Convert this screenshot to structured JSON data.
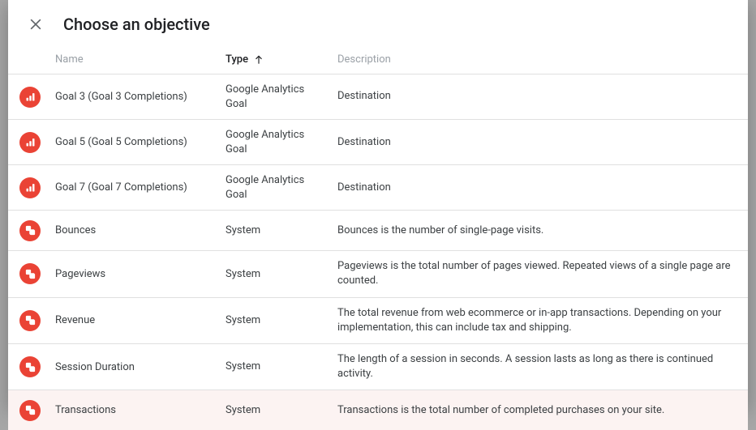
{
  "dialog": {
    "title": "Choose an objective"
  },
  "columns": {
    "name": "Name",
    "type": "Type",
    "description": "Description"
  },
  "rows": [
    {
      "iconType": "ga",
      "name": "Goal 3 (Goal 3 Completions)",
      "type": "Google Analytics Goal",
      "description": "Destination",
      "highlight": false
    },
    {
      "iconType": "ga",
      "name": "Goal 5 (Goal 5 Completions)",
      "type": "Google Analytics Goal",
      "description": "Destination",
      "highlight": false
    },
    {
      "iconType": "ga",
      "name": "Goal 7 (Goal 7 Completions)",
      "type": "Google Analytics Goal",
      "description": "Destination",
      "highlight": false
    },
    {
      "iconType": "system",
      "name": "Bounces",
      "type": "System",
      "description": "Bounces is the number of single-page visits.",
      "highlight": false
    },
    {
      "iconType": "system",
      "name": "Pageviews",
      "type": "System",
      "description": "Pageviews is the total number of pages viewed. Repeated views of a single page are counted.",
      "highlight": false
    },
    {
      "iconType": "system",
      "name": "Revenue",
      "type": "System",
      "description": "The total revenue from web ecommerce or in-app transactions. Depending on your implementation, this can include tax and shipping.",
      "highlight": false
    },
    {
      "iconType": "system",
      "name": "Session Duration",
      "type": "System",
      "description": "The length of a session in seconds. A session lasts as long as there is continued activity.",
      "highlight": false
    },
    {
      "iconType": "system",
      "name": "Transactions",
      "type": "System",
      "description": "Transactions is the total number of completed purchases on your site.",
      "highlight": true
    }
  ]
}
